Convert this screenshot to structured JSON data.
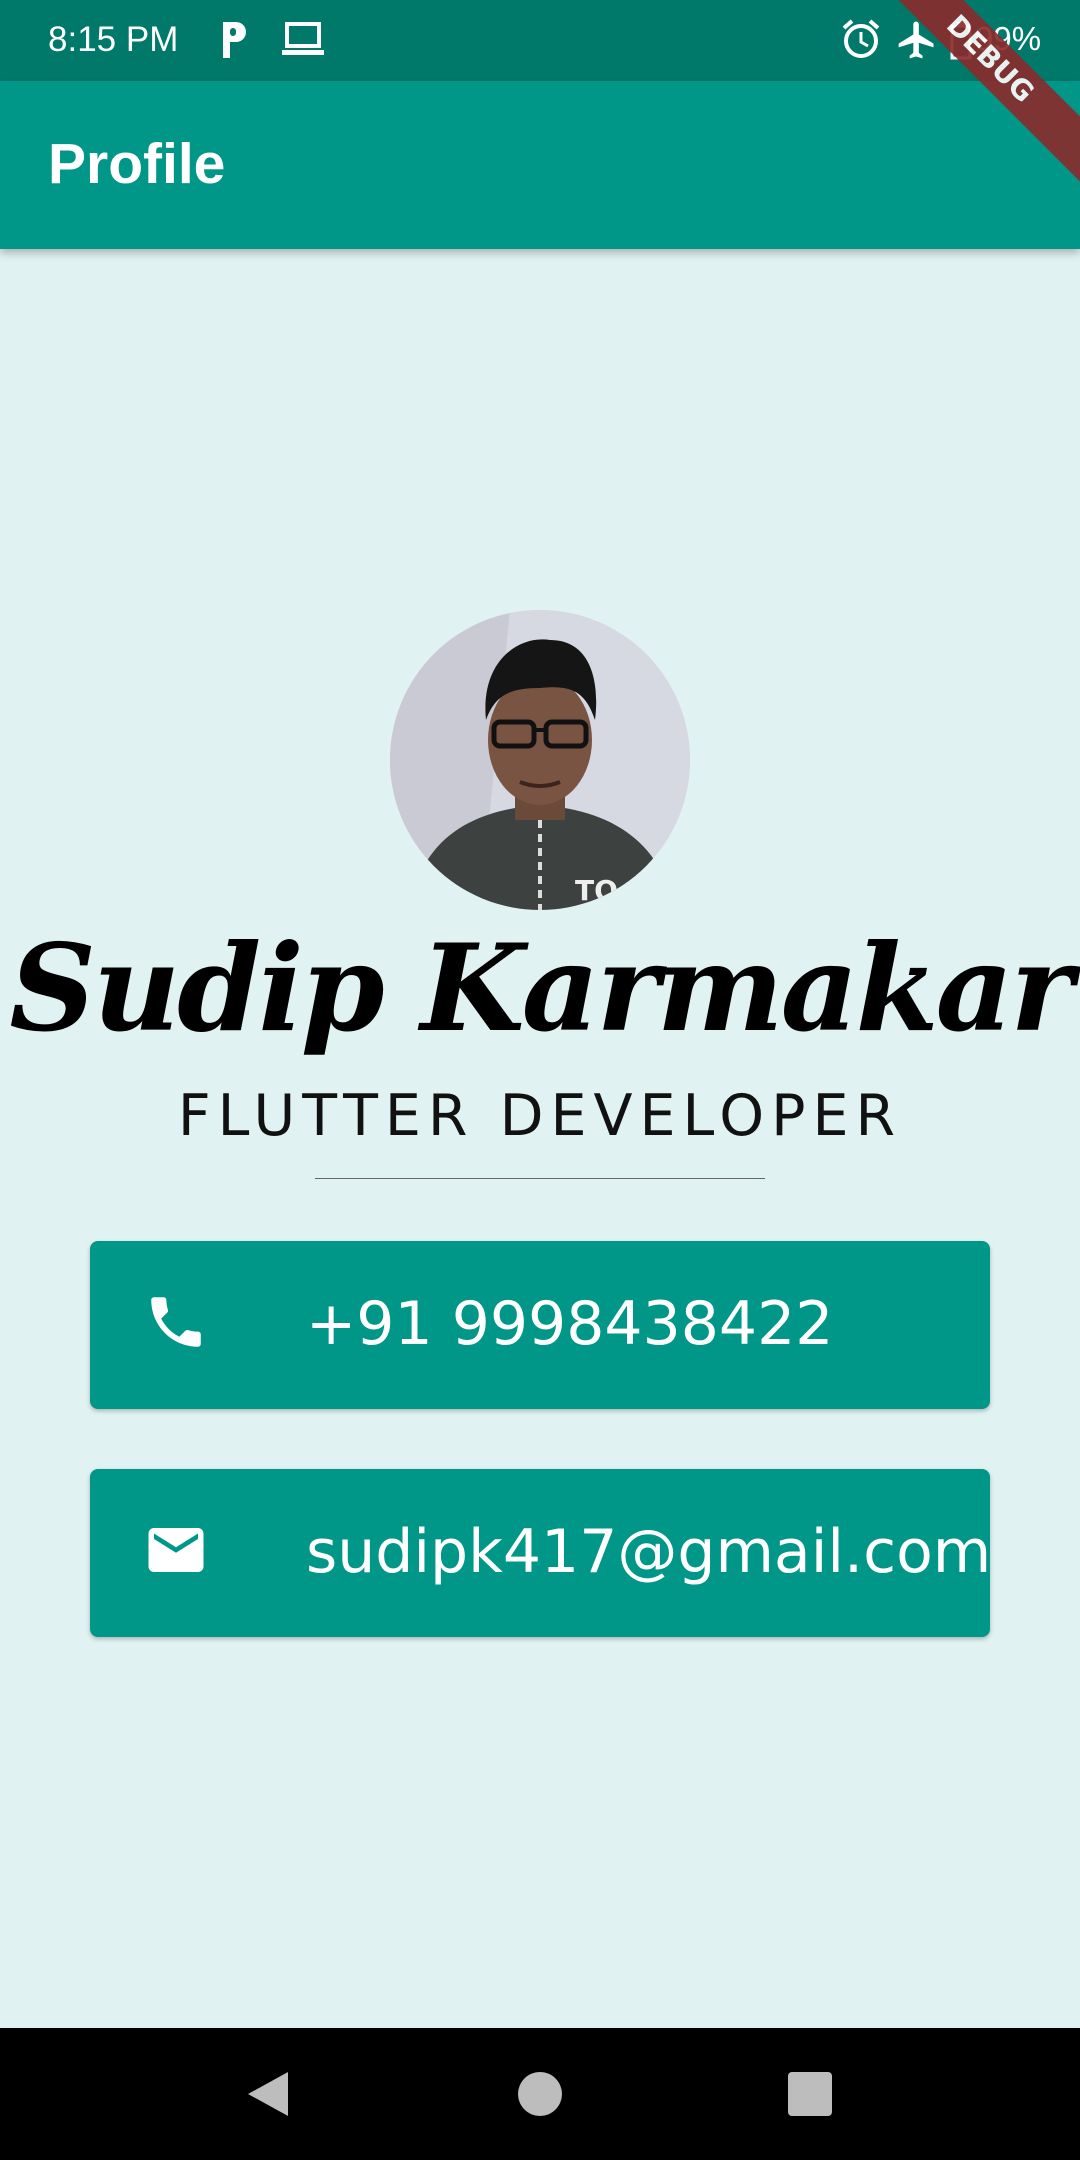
{
  "status_bar": {
    "time": "8:15 PM",
    "battery": "99%",
    "icons": [
      "parking-icon",
      "laptop-icon",
      "alarm-icon",
      "airplane-icon",
      "battery-charging-icon"
    ]
  },
  "debug_banner": "DEBUG",
  "app_bar": {
    "title": "Profile"
  },
  "profile": {
    "name": "Sudip Karmakar",
    "role": "FLUTTER DEVELOPER",
    "avatar_icon": "profile-photo"
  },
  "contacts": [
    {
      "icon": "phone-icon",
      "text": "+91 9998438422"
    },
    {
      "icon": "mail-icon",
      "text": "sudipk417@gmail.com"
    }
  ],
  "nav_bar": {
    "icons": [
      "back-icon",
      "home-icon",
      "recents-icon"
    ]
  },
  "colors": {
    "status_bar": "#00796b",
    "app_bar": "#009688",
    "background": "#e0f2f1",
    "card": "#009688"
  }
}
